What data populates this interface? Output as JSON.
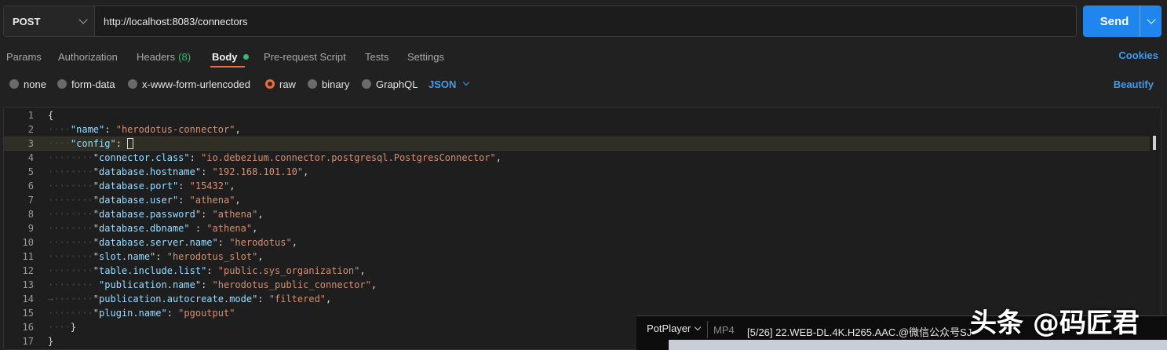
{
  "request": {
    "method": "POST",
    "url": "http://localhost:8083/connectors",
    "send_label": "Send"
  },
  "tabs": [
    {
      "label": "Params"
    },
    {
      "label": "Authorization"
    },
    {
      "label": "Headers",
      "count": "(8)"
    },
    {
      "label": "Body"
    },
    {
      "label": "Pre-request Script"
    },
    {
      "label": "Tests"
    },
    {
      "label": "Settings"
    }
  ],
  "cookies_label": "Cookies",
  "body_types": [
    {
      "label": "none"
    },
    {
      "label": "form-data"
    },
    {
      "label": "x-www-form-urlencoded"
    },
    {
      "label": "raw",
      "selected": true
    },
    {
      "label": "binary"
    },
    {
      "label": "GraphQL"
    }
  ],
  "format": "JSON",
  "beautify_label": "Beautify",
  "editor": {
    "lines": [
      {
        "n": "1",
        "tokens": [
          [
            "p",
            "{"
          ]
        ]
      },
      {
        "n": "2",
        "tokens": [
          [
            "w",
            "····"
          ],
          [
            "k",
            "\"name\""
          ],
          [
            "p",
            ": "
          ],
          [
            "s",
            "\"herodotus-connector\""
          ],
          [
            "p",
            ","
          ]
        ]
      },
      {
        "n": "3",
        "tokens": [
          [
            "w",
            "····"
          ],
          [
            "k",
            "\"config\""
          ],
          [
            "p",
            ": "
          ]
        ],
        "caret": true
      },
      {
        "n": "4",
        "tokens": [
          [
            "w",
            "········"
          ],
          [
            "k",
            "\"connector.class\""
          ],
          [
            "p",
            ": "
          ],
          [
            "s",
            "\"io.debezium.connector.postgresql.PostgresConnector\""
          ],
          [
            "p",
            ","
          ]
        ]
      },
      {
        "n": "5",
        "tokens": [
          [
            "w",
            "········"
          ],
          [
            "k",
            "\"database.hostname\""
          ],
          [
            "p",
            ": "
          ],
          [
            "s",
            "\"192.168.101.10\""
          ],
          [
            "p",
            ","
          ]
        ]
      },
      {
        "n": "6",
        "tokens": [
          [
            "w",
            "········"
          ],
          [
            "k",
            "\"database.port\""
          ],
          [
            "p",
            ": "
          ],
          [
            "s",
            "\"15432\""
          ],
          [
            "p",
            ","
          ]
        ]
      },
      {
        "n": "7",
        "tokens": [
          [
            "w",
            "········"
          ],
          [
            "k",
            "\"database.user\""
          ],
          [
            "p",
            ": "
          ],
          [
            "s",
            "\"athena\""
          ],
          [
            "p",
            ","
          ]
        ]
      },
      {
        "n": "8",
        "tokens": [
          [
            "w",
            "········"
          ],
          [
            "k",
            "\"database.password\""
          ],
          [
            "p",
            ": "
          ],
          [
            "s",
            "\"athena\""
          ],
          [
            "p",
            ","
          ]
        ]
      },
      {
        "n": "9",
        "tokens": [
          [
            "w",
            "········"
          ],
          [
            "k",
            "\"database.dbname\""
          ],
          [
            "p",
            " : "
          ],
          [
            "s",
            "\"athena\""
          ],
          [
            "p",
            ","
          ]
        ]
      },
      {
        "n": "10",
        "tokens": [
          [
            "w",
            "········"
          ],
          [
            "k",
            "\"database.server.name\""
          ],
          [
            "p",
            ": "
          ],
          [
            "s",
            "\"herodotus\""
          ],
          [
            "p",
            ","
          ]
        ]
      },
      {
        "n": "11",
        "tokens": [
          [
            "w",
            "········"
          ],
          [
            "k",
            "\"slot.name\""
          ],
          [
            "p",
            ": "
          ],
          [
            "s",
            "\"herodotus_slot\""
          ],
          [
            "p",
            ","
          ]
        ]
      },
      {
        "n": "12",
        "tokens": [
          [
            "w",
            "········"
          ],
          [
            "k",
            "\"table.include.list\""
          ],
          [
            "p",
            ": "
          ],
          [
            "s",
            "\"public.sys_organization\""
          ],
          [
            "p",
            ","
          ]
        ]
      },
      {
        "n": "13",
        "tokens": [
          [
            "w",
            "········ "
          ],
          [
            "k",
            "\"publication.name\""
          ],
          [
            "p",
            ": "
          ],
          [
            "s",
            "\"herodotus_public_connector\""
          ],
          [
            "p",
            ","
          ]
        ]
      },
      {
        "n": "14",
        "tokens": [
          [
            "w",
            "→·······"
          ],
          [
            "k",
            "\"publication.autocreate.mode\""
          ],
          [
            "p",
            ": "
          ],
          [
            "s",
            "\"filtered\""
          ],
          [
            "p",
            ","
          ]
        ]
      },
      {
        "n": "15",
        "tokens": [
          [
            "w",
            "········"
          ],
          [
            "k",
            "\"plugin.name\""
          ],
          [
            "p",
            ": "
          ],
          [
            "s",
            "\"pgoutput\""
          ]
        ]
      },
      {
        "n": "16",
        "tokens": [
          [
            "w",
            "····"
          ],
          [
            "p",
            "}"
          ]
        ]
      },
      {
        "n": "17",
        "tokens": [
          [
            "p",
            "}"
          ]
        ]
      }
    ]
  },
  "player": {
    "name": "PotPlayer",
    "format": "MP4",
    "title": "[5/26] 22.WEB-DL.4K.H265.AAC.@微信公众号SJ"
  },
  "watermark": "头条 @码匠君"
}
